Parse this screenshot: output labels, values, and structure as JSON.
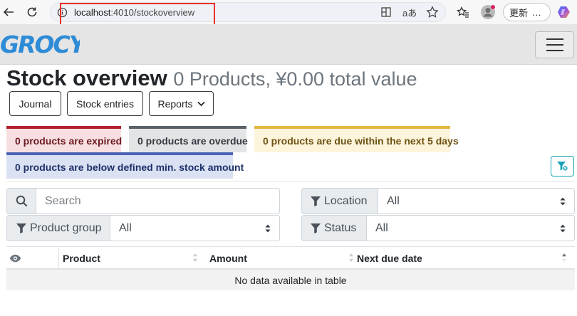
{
  "browser": {
    "url_host": "localhost",
    "url_path": ":4010/stockoverview",
    "update_label": "更新"
  },
  "app": {
    "logo_text": "GROCY"
  },
  "header": {
    "title": "Stock overview",
    "subtitle": "0 Products, ¥0.00 total value"
  },
  "toolbar": {
    "journal_label": "Journal",
    "stock_entries_label": "Stock entries",
    "reports_label": "Reports"
  },
  "status": {
    "expired": "0 products are expired",
    "overdue": "0 products are overdue",
    "due_soon": "0 products are due within the next 5 days",
    "below_min": "0 products are below defined min. stock amount"
  },
  "filters": {
    "search_placeholder": "Search",
    "location_label": "Location",
    "location_value": "All",
    "product_group_label": "Product group",
    "product_group_value": "All",
    "status_label": "Status",
    "status_value": "All"
  },
  "table": {
    "columns": [
      "Product",
      "Amount",
      "Next due date"
    ],
    "empty_text": "No data available in table"
  },
  "colors": {
    "expired": "#b21f2d",
    "overdue": "#5a6268",
    "due_soon": "#e0b840",
    "below_min": "#4a62b5",
    "logo": "#2e8bd6",
    "highlight": "#e8302a"
  }
}
